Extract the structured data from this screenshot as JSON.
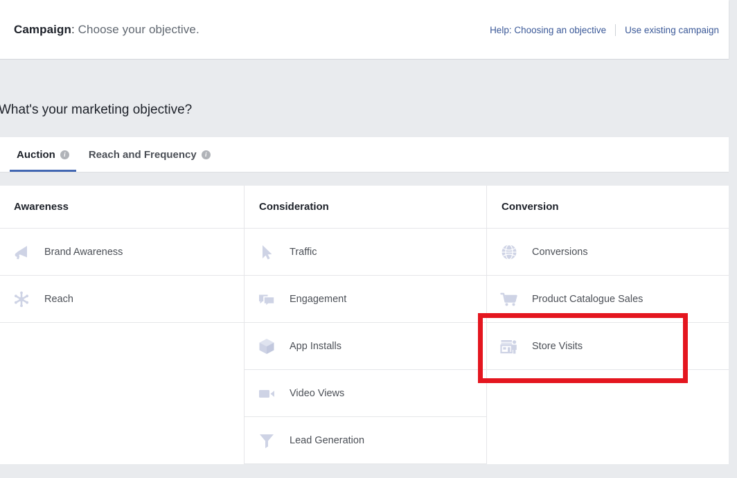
{
  "header": {
    "breadcrumb_strong": "Campaign",
    "breadcrumb_colon": ":",
    "breadcrumb_rest": " Choose your objective.",
    "help_link": "Help: Choosing an objective",
    "existing_campaign_link": "Use existing campaign"
  },
  "question": {
    "title": "What's your marketing objective?"
  },
  "tabs": [
    {
      "label": "Auction",
      "active": true,
      "info": "i"
    },
    {
      "label": "Reach and Frequency",
      "active": false,
      "info": "i"
    }
  ],
  "columns": [
    {
      "header": "Awareness",
      "items": [
        {
          "label": "Brand Awareness",
          "icon": "megaphone-icon"
        },
        {
          "label": "Reach",
          "icon": "starburst-icon"
        }
      ]
    },
    {
      "header": "Consideration",
      "items": [
        {
          "label": "Traffic",
          "icon": "cursor-arrow-icon"
        },
        {
          "label": "Engagement",
          "icon": "speech-bubbles-icon"
        },
        {
          "label": "App Installs",
          "icon": "cube-box-icon"
        },
        {
          "label": "Video Views",
          "icon": "video-camera-icon"
        },
        {
          "label": "Lead Generation",
          "icon": "funnel-icon"
        }
      ]
    },
    {
      "header": "Conversion",
      "items": [
        {
          "label": "Conversions",
          "icon": "globe-icon"
        },
        {
          "label": "Product Catalogue Sales",
          "icon": "shopping-cart-icon"
        },
        {
          "label": "Store Visits",
          "icon": "storefront-person-icon"
        }
      ]
    }
  ],
  "annotation": {
    "target": "Store Visits",
    "color": "#e4161f"
  },
  "colors": {
    "accent_blue": "#4267b2",
    "link_blue": "#3b5998",
    "icon_blue_grey": "#ced3e5",
    "page_bg": "#e9ebee",
    "text_dark": "#1d2129",
    "text_grey": "#4b4f56"
  }
}
